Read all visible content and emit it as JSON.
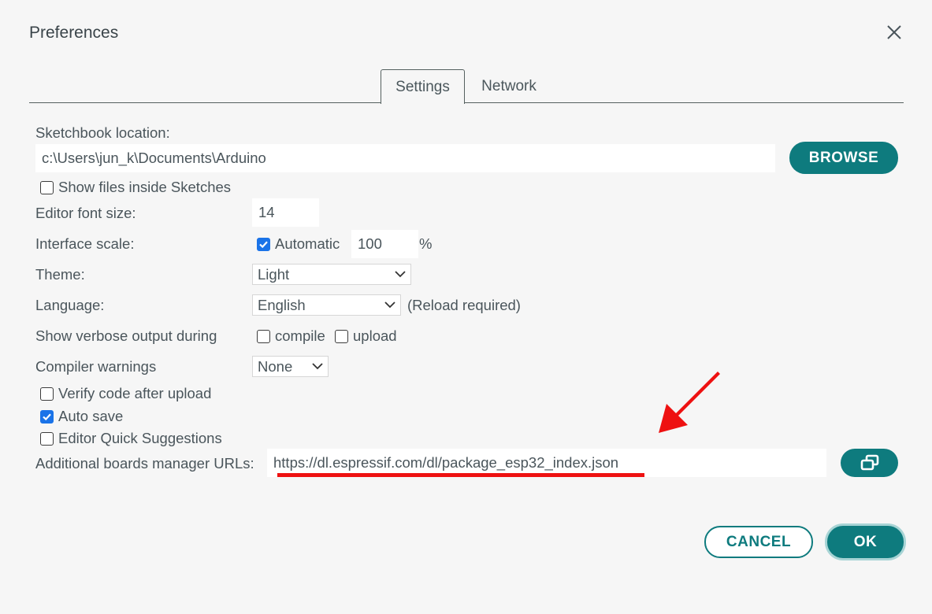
{
  "window": {
    "title": "Preferences"
  },
  "tabs": [
    {
      "label": "Settings",
      "active": true
    },
    {
      "label": "Network",
      "active": false
    }
  ],
  "sketchbook": {
    "label": "Sketchbook location:",
    "value": "c:\\Users\\jun_k\\Documents\\Arduino",
    "browse_label": "BROWSE",
    "show_files_label": "Show files inside Sketches",
    "show_files_checked": false
  },
  "editor_font": {
    "label": "Editor font size:",
    "value": "14"
  },
  "interface_scale": {
    "label": "Interface scale:",
    "automatic_label": "Automatic",
    "automatic_checked": true,
    "value": "100",
    "unit": "%"
  },
  "theme": {
    "label": "Theme:",
    "selected": "Light"
  },
  "language": {
    "label": "Language:",
    "selected": "English",
    "note": "(Reload required)"
  },
  "verbose": {
    "label": "Show verbose output during",
    "compile_label": "compile",
    "compile_checked": false,
    "upload_label": "upload",
    "upload_checked": false
  },
  "compiler_warnings": {
    "label": "Compiler warnings",
    "selected": "None"
  },
  "options": [
    {
      "label": "Verify code after upload",
      "checked": false
    },
    {
      "label": "Auto save",
      "checked": true
    },
    {
      "label": "Editor Quick Suggestions",
      "checked": false
    }
  ],
  "boards_urls": {
    "label": "Additional boards manager URLs:",
    "value": "https://dl.espressif.com/dl/package_esp32_index.json"
  },
  "footer": {
    "cancel_label": "CANCEL",
    "ok_label": "OK"
  },
  "colors": {
    "accent": "#0e7b7e",
    "annotation": "#ee1111",
    "checkbox": "#1a73e8"
  },
  "icons": {
    "close": "close-icon",
    "open_window": "open-window-icon",
    "chevron": "chevron-down-icon",
    "check": "check-icon"
  }
}
